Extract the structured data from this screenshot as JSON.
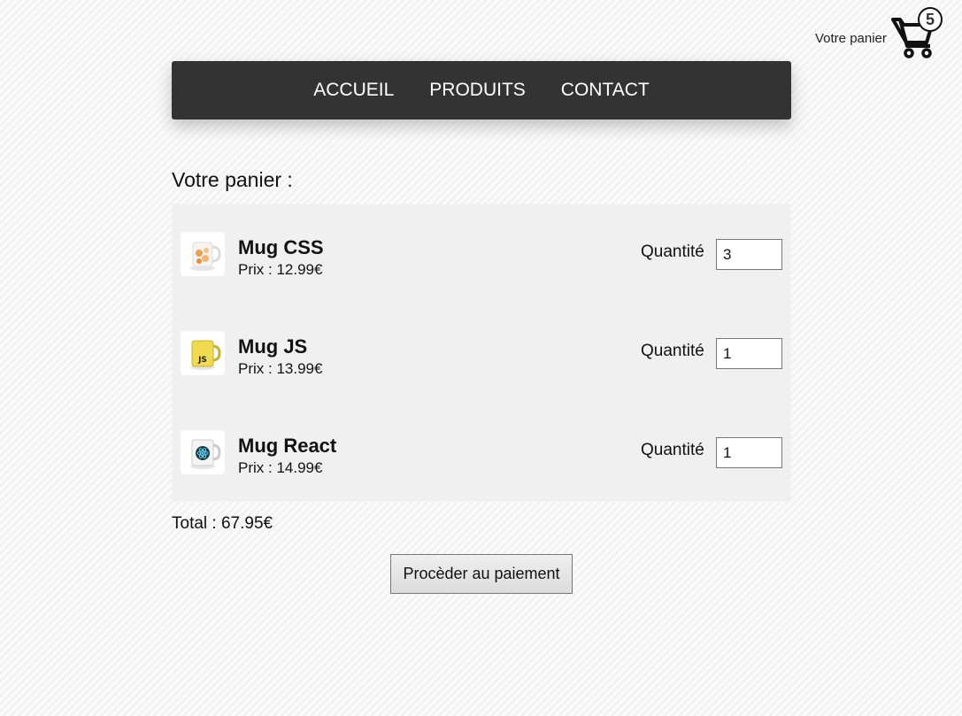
{
  "cart_widget": {
    "label": "Votre panier",
    "count": "5"
  },
  "nav": {
    "items": [
      {
        "label": "ACCUEIL"
      },
      {
        "label": "PRODUITS"
      },
      {
        "label": "CONTACT"
      }
    ]
  },
  "cart": {
    "title": "Votre panier :",
    "quantity_label": "Quantité",
    "items": [
      {
        "name": "Mug CSS",
        "price": "Prix : 12.99€",
        "quantity": "3",
        "icon": "mug-css-icon"
      },
      {
        "name": "Mug JS",
        "price": "Prix : 13.99€",
        "quantity": "1",
        "icon": "mug-js-icon"
      },
      {
        "name": "Mug React",
        "price": "Prix : 14.99€",
        "quantity": "1",
        "icon": "mug-react-icon"
      }
    ],
    "total": "Total : 67.95€",
    "checkout_label": "Procèder au paiement"
  },
  "colors": {
    "navbar": "#333333",
    "cart_list_bg": "#f0f0f0",
    "js_yellow": "#f0db4f"
  }
}
